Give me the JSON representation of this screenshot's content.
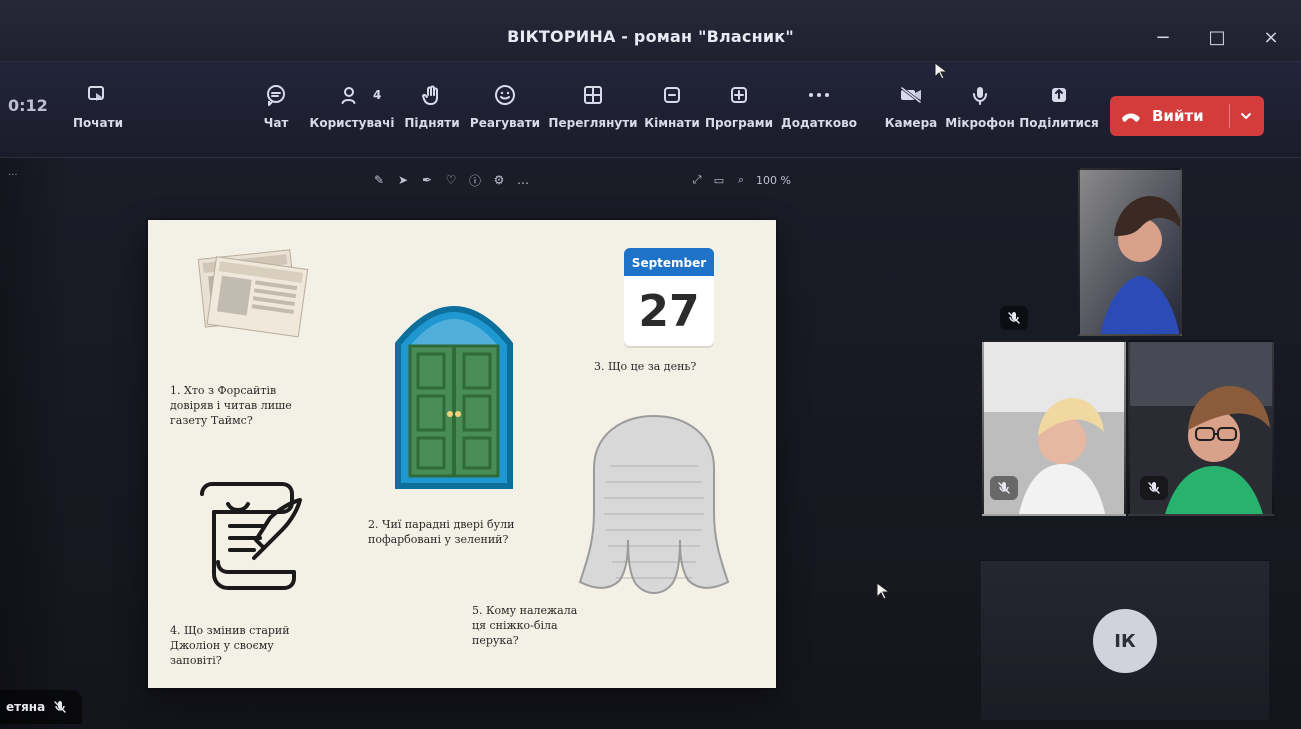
{
  "window": {
    "title": "ВІКТОРИНА - роман \"Власник\"",
    "controls": [
      "−",
      "□",
      "×"
    ]
  },
  "toolbar": {
    "time": "0:12",
    "start_label": "Почати",
    "items": [
      {
        "name": "chat",
        "label": "Чат",
        "icon": "chat-icon"
      },
      {
        "name": "people",
        "label": "Користувачі",
        "icon": "people-icon",
        "count": "4"
      },
      {
        "name": "raise",
        "label": "Підняти",
        "icon": "hand-icon"
      },
      {
        "name": "react",
        "label": "Реагувати",
        "icon": "smile-icon"
      },
      {
        "name": "view",
        "label": "Переглянути",
        "icon": "grid-icon"
      },
      {
        "name": "rooms",
        "label": "Кімнати",
        "icon": "rooms-icon"
      },
      {
        "name": "apps",
        "label": "Програми",
        "icon": "plus-icon"
      },
      {
        "name": "more",
        "label": "Додатково",
        "icon": "more-icon"
      },
      {
        "name": "camera",
        "label": "Камера",
        "icon": "camera-off-icon"
      },
      {
        "name": "mic",
        "label": "Мікрофон",
        "icon": "mic-icon"
      },
      {
        "name": "share",
        "label": "Поділитися",
        "icon": "share-icon"
      }
    ],
    "leave_label": "Вийти"
  },
  "share_toolbar": {
    "zoom_text": "100 %"
  },
  "slide": {
    "calendar": {
      "month": "September",
      "day": "27"
    },
    "q1": "1. Хто з Форсайтів\nдовіряв і читав лише\nгазету Таймс?",
    "q2": "2. Чиї парадні двері були\nпофарбовані у зелений?",
    "q3": "3. Що це за день?",
    "q4": "4. Що змінив старий\nДжоліон у своєму\nзаповіті?",
    "q5": "5. Кому належала\nця сніжко-біла\nперука?"
  },
  "participants": {
    "bottom_left_name": "етяна",
    "avatar_initials": "ІК"
  },
  "colors": {
    "leave_red": "#d43b3b",
    "toolbar_bg": "#22243a",
    "slide_bg": "#f3f0e6"
  }
}
